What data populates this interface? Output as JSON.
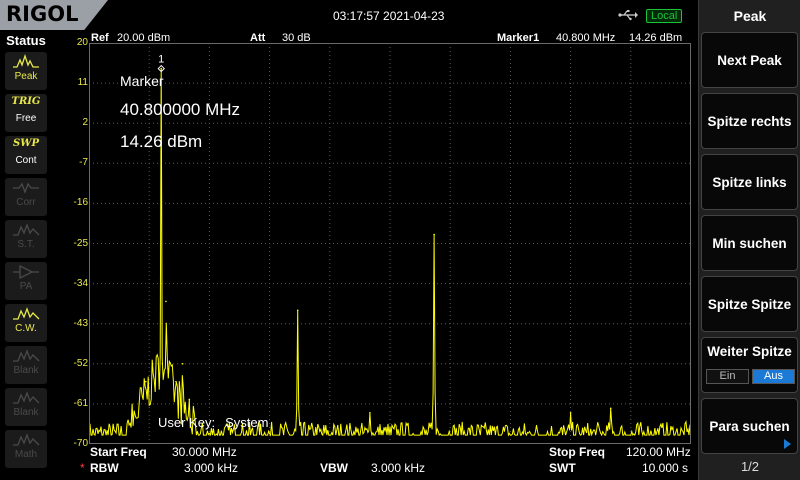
{
  "topbar": {
    "logo": "RIGOL",
    "datetime": "03:17:57 2021-04-23",
    "remote_status": "Local"
  },
  "status_panel": {
    "title": "Status",
    "items": [
      {
        "icon": "peak-icon",
        "label": "Peak",
        "active": true
      },
      {
        "icon": "trig-icon",
        "glyph": "TRIG",
        "label": "Free",
        "active": true
      },
      {
        "icon": "sweep-icon",
        "glyph": "SWP",
        "label": "Cont",
        "active": true
      },
      {
        "icon": "corr-icon",
        "label": "Corr",
        "active": false
      },
      {
        "icon": "st-icon",
        "label": "S.T.",
        "active": false
      },
      {
        "icon": "pa-icon",
        "label": "PA",
        "active": false
      },
      {
        "icon": "cw-icon",
        "label": "C.W.",
        "active": true
      },
      {
        "icon": "blank-icon",
        "label": "Blank",
        "active": false
      },
      {
        "icon": "blank-icon",
        "label": "Blank",
        "active": false
      },
      {
        "icon": "math-icon",
        "label": "Math",
        "active": false
      }
    ]
  },
  "header": {
    "ref_label": "Ref",
    "ref_value": "20.00 dBm",
    "att_label": "Att",
    "att_value": "30 dB",
    "marker_label": "Marker1",
    "marker_freq": "40.800 MHz",
    "marker_amp": "14.26 dBm"
  },
  "marker_readout": {
    "title": "Marker",
    "freq": "40.800000 MHz",
    "amp": "14.26 dBm",
    "marker_number": "1"
  },
  "user_key": {
    "label": "User Key:",
    "value": "System"
  },
  "footer": {
    "start_label": "Start Freq",
    "start_value": "30.000 MHz",
    "stop_label": "Stop Freq",
    "stop_value": "120.00 MHz",
    "rbw_star": "*",
    "rbw_label": "RBW",
    "rbw_value": "3.000 kHz",
    "vbw_label": "VBW",
    "vbw_value": "3.000 kHz",
    "swt_label": "SWT",
    "swt_value": "10.000 s"
  },
  "softkeys": {
    "title": "Peak",
    "buttons": [
      "Next Peak",
      "Spitze rechts",
      "Spitze links",
      "Min suchen",
      "Spitze Spitze"
    ],
    "toggle": {
      "label": "Weiter Spitze",
      "options": [
        "Ein",
        "Aus"
      ],
      "selected": "Aus"
    },
    "last_button": "Para suchen",
    "page": "1/2"
  },
  "colors": {
    "trace": "#ffff00",
    "grid": "#5a5a5a",
    "scale": "#e8e84a",
    "selected": "#1a7ad6",
    "local": "#19c43a"
  },
  "chart_data": {
    "type": "line",
    "xlabel": "",
    "ylabel": "",
    "xlim": [
      30,
      120
    ],
    "ylim": [
      -70,
      20
    ],
    "x_unit": "MHz",
    "y_unit": "dBm",
    "y_ticks": [
      "20",
      "11",
      "2",
      "-7",
      "-16",
      "-25",
      "-34",
      "-43",
      "-52",
      "-61",
      "-70"
    ],
    "noise_floor_dbm": -68,
    "peaks": [
      {
        "freq_mhz": 40.8,
        "level_dbm": 14.26
      },
      {
        "freq_mhz": 38.5,
        "level_dbm": -56
      },
      {
        "freq_mhz": 41.5,
        "level_dbm": -38
      },
      {
        "freq_mhz": 43.0,
        "level_dbm": -56
      },
      {
        "freq_mhz": 44.0,
        "level_dbm": -52
      },
      {
        "freq_mhz": 45.0,
        "level_dbm": -60
      },
      {
        "freq_mhz": 61.2,
        "level_dbm": -40
      },
      {
        "freq_mhz": 81.6,
        "level_dbm": -23
      },
      {
        "freq_mhz": 72.0,
        "level_dbm": -63
      },
      {
        "freq_mhz": 102.0,
        "level_dbm": -63
      },
      {
        "freq_mhz": 108.0,
        "level_dbm": -62
      }
    ],
    "marker": {
      "freq_mhz": 40.8,
      "level_dbm": 14.26,
      "label": "1"
    },
    "grid": true
  }
}
